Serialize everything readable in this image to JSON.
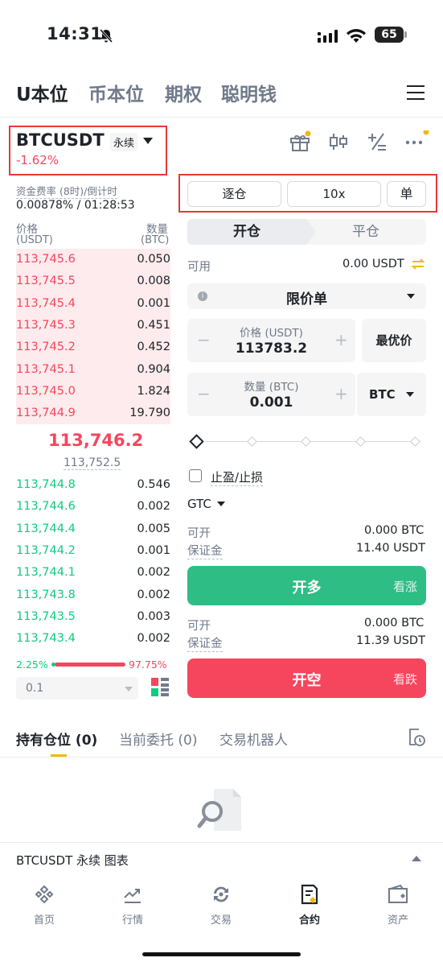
{
  "status": {
    "time": "14:31",
    "battery": "65"
  },
  "top_tabs": [
    {
      "label": "U本位",
      "active": true
    },
    {
      "label": "币本位"
    },
    {
      "label": "期权"
    },
    {
      "label": "聪明钱"
    }
  ],
  "header": {
    "symbol": "BTCUSDT",
    "badge": "永续",
    "change": "-1.62%"
  },
  "funding": {
    "label": "资金费率 (8时)/倒计时",
    "value": "0.00878% / 01:28:53"
  },
  "orderbook": {
    "price_label": "价格",
    "price_unit": "(USDT)",
    "qty_label": "数量",
    "qty_unit": "(BTC)",
    "asks": [
      {
        "p": "113,745.6",
        "q": "0.050"
      },
      {
        "p": "113,745.5",
        "q": "0.008"
      },
      {
        "p": "113,745.4",
        "q": "0.001"
      },
      {
        "p": "113,745.3",
        "q": "0.451"
      },
      {
        "p": "113,745.2",
        "q": "0.452"
      },
      {
        "p": "113,745.1",
        "q": "0.904"
      },
      {
        "p": "113,745.0",
        "q": "1.824"
      },
      {
        "p": "113,744.9",
        "q": "19.790"
      }
    ],
    "last_price": "113,746.2",
    "mark_price": "113,752.5",
    "bids": [
      {
        "p": "113,744.8",
        "q": "0.546"
      },
      {
        "p": "113,744.6",
        "q": "0.002"
      },
      {
        "p": "113,744.4",
        "q": "0.005"
      },
      {
        "p": "113,744.2",
        "q": "0.001"
      },
      {
        "p": "113,744.1",
        "q": "0.002"
      },
      {
        "p": "113,743.8",
        "q": "0.002"
      },
      {
        "p": "113,743.5",
        "q": "0.003"
      },
      {
        "p": "113,743.4",
        "q": "0.002"
      }
    ],
    "buy_ratio": "2.25%",
    "sell_ratio": "97.75%",
    "buy_ratio_fraction": 0.0225,
    "step": "0.1"
  },
  "order_form": {
    "margin_mode": "逐仓",
    "leverage": "10x",
    "position_mode": "单",
    "open_tab": "开仓",
    "close_tab": "平仓",
    "available_label": "可用",
    "available_value": "0.00 USDT",
    "order_type": "限价单",
    "price_label": "价格 (USDT)",
    "price_value": "113783.2",
    "best_price": "最优价",
    "qty_label": "数量 (BTC)",
    "qty_value": "0.001",
    "qty_unit": "BTC",
    "tpsl": "止盈/止损",
    "tif": "GTC",
    "long": {
      "open_label": "可开",
      "open_value": "0.000 BTC",
      "margin_label": "保证金",
      "margin_value": "11.40 USDT",
      "button": "开多",
      "side": "看涨"
    },
    "short": {
      "open_label": "可开",
      "open_value": "0.000 BTC",
      "margin_label": "保证金",
      "margin_value": "11.39 USDT",
      "button": "开空",
      "side": "看跌"
    }
  },
  "bottom_tabs": [
    {
      "label": "持有仓位 (0)",
      "active": true
    },
    {
      "label": "当前委托 (0)"
    },
    {
      "label": "交易机器人"
    }
  ],
  "chart_bar": "BTCUSDT 永续  图表",
  "nav": [
    {
      "label": "首页",
      "icon": "binance-logo-icon"
    },
    {
      "label": "行情",
      "icon": "market-chart-icon"
    },
    {
      "label": "交易",
      "icon": "trade-exchange-icon"
    },
    {
      "label": "合约",
      "icon": "futures-contract-icon",
      "active": true
    },
    {
      "label": "资产",
      "icon": "wallet-icon"
    }
  ],
  "colors": {
    "up": "#0ecb81",
    "down": "#f6465d",
    "accent": "#f0b90b",
    "highlight_box": "#e53935"
  }
}
